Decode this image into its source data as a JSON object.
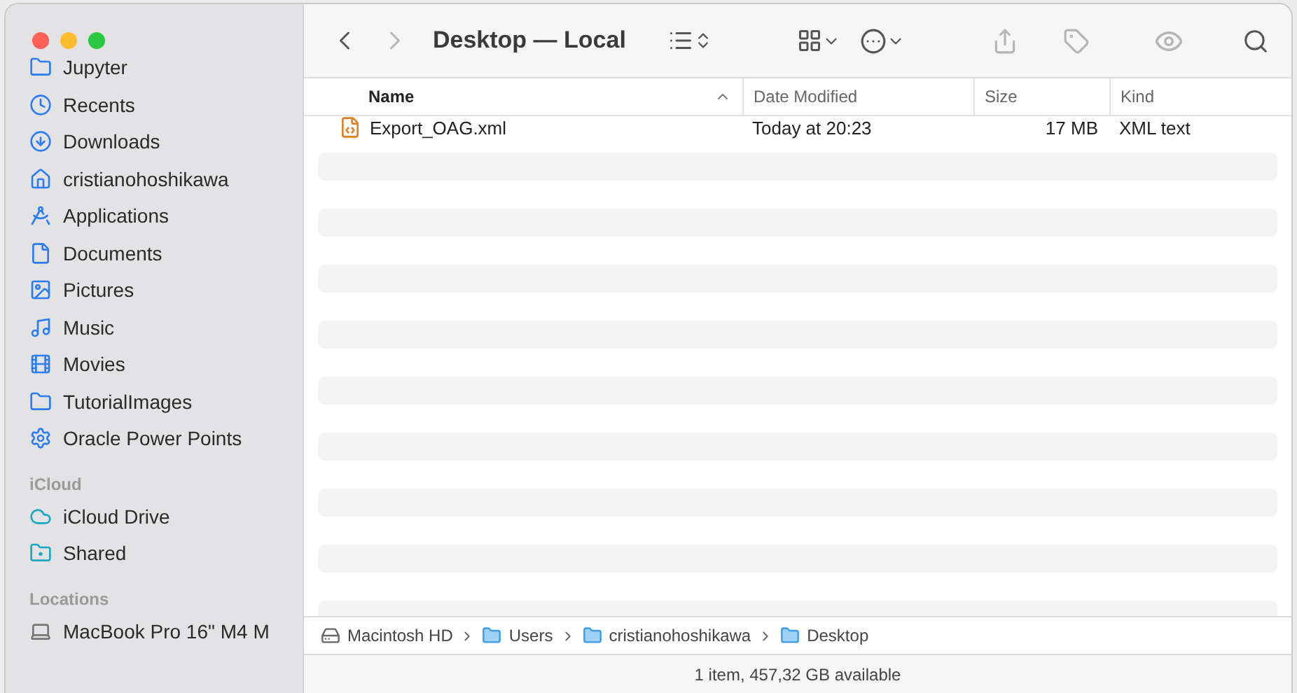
{
  "window": {
    "title": "Desktop — Local"
  },
  "toolbar": {
    "back": {
      "disabled": false
    },
    "forward": {
      "disabled": true
    },
    "share": {
      "disabled": true
    },
    "tag": {
      "disabled": true
    },
    "preview": {
      "disabled": true
    }
  },
  "sidebar": {
    "sections": [
      {
        "items": [
          {
            "label": "Jupyter"
          },
          {
            "label": "Recents"
          },
          {
            "label": "Downloads"
          },
          {
            "label": "cristianohoshikawa"
          },
          {
            "label": "Applications"
          },
          {
            "label": "Documents"
          },
          {
            "label": "Pictures"
          },
          {
            "label": "Music"
          },
          {
            "label": "Movies"
          },
          {
            "label": "TutorialImages"
          },
          {
            "label": "Oracle Power Points"
          }
        ]
      },
      {
        "heading": "iCloud",
        "items": [
          {
            "label": "iCloud Drive"
          },
          {
            "label": "Shared"
          }
        ]
      },
      {
        "heading": "Locations",
        "items": [
          {
            "label": "MacBook Pro 16\" M4 M"
          }
        ]
      }
    ]
  },
  "table": {
    "columns": [
      {
        "label": "Name",
        "sorted": true
      },
      {
        "label": "Date Modified",
        "sorted": false
      },
      {
        "label": "Size",
        "sorted": false
      },
      {
        "label": "Kind",
        "sorted": false
      }
    ],
    "rows": [
      {
        "name": "Export_OAG.xml",
        "date_modified": "Today at 20:23",
        "size": "17 MB",
        "kind": "XML text"
      }
    ]
  },
  "path_bar": [
    "Macintosh HD",
    "Users",
    "cristianohoshikawa",
    "Desktop"
  ],
  "status_bar": "1 item, 457,32 GB available"
}
